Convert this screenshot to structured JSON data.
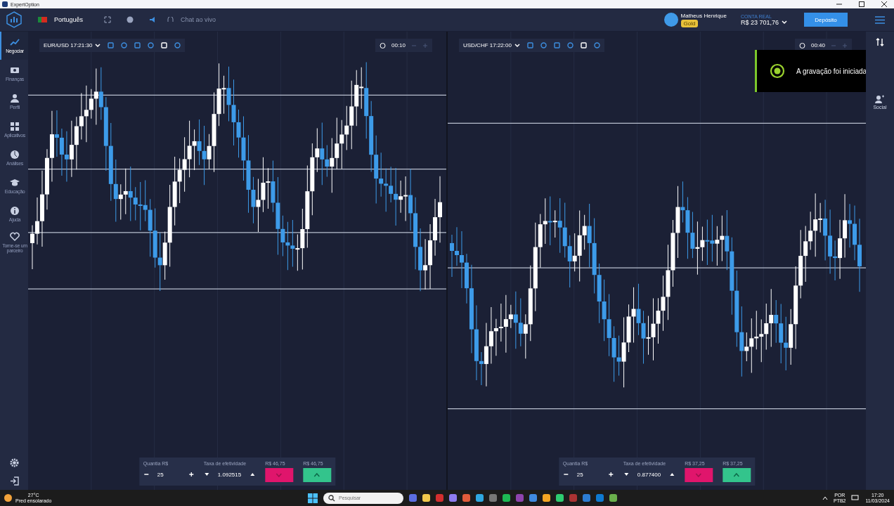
{
  "window": {
    "title": "ExpertOption"
  },
  "topbar": {
    "language": "Português",
    "chat": "Chat ao vivo",
    "user": "Matheus Henrique",
    "badge": "Gold",
    "account_label": "CONTA REAL",
    "balance": "R$ 23 701,76",
    "deposit": "Depósito"
  },
  "sidebar": {
    "items": [
      {
        "label": "Negociar",
        "selected": true
      },
      {
        "label": "Finanças",
        "selected": false
      },
      {
        "label": "Perfil",
        "selected": false
      },
      {
        "label": "Aplicativos",
        "selected": false
      },
      {
        "label": "Análises",
        "selected": false
      },
      {
        "label": "Educação",
        "selected": false
      },
      {
        "label": "Ajuda",
        "selected": false
      },
      {
        "label": "Torne-se um parceiro",
        "selected": false
      }
    ]
  },
  "right_sidebar": {
    "items": [
      {
        "label": "Social"
      }
    ]
  },
  "charts": [
    {
      "pair": "EUR/USD 17:21:30",
      "timer": "00:10",
      "amount_label": "Quantia R$",
      "amount": "25",
      "rate_label": "Taxa de efetividade",
      "rate": "1.092515",
      "down_payout": "R$ 46,75",
      "up_payout": "R$ 46,75"
    },
    {
      "pair": "USD/CHF 17:22:00",
      "timer": "00:40",
      "amount_label": "Quantia R$",
      "amount": "25",
      "rate_label": "Taxa de efetividade",
      "rate": "0.877400",
      "down_payout": "R$ 37,25",
      "up_payout": "R$ 37,25"
    }
  ],
  "notification": {
    "text": "A gravação foi iniciada"
  },
  "taskbar": {
    "temperature": "27°C",
    "weather": "Pred ensolarado",
    "search_placeholder": "Pesquisar",
    "language": "POR",
    "layout": "PTB2",
    "time": "17:20",
    "date": "11/03/2024"
  }
}
